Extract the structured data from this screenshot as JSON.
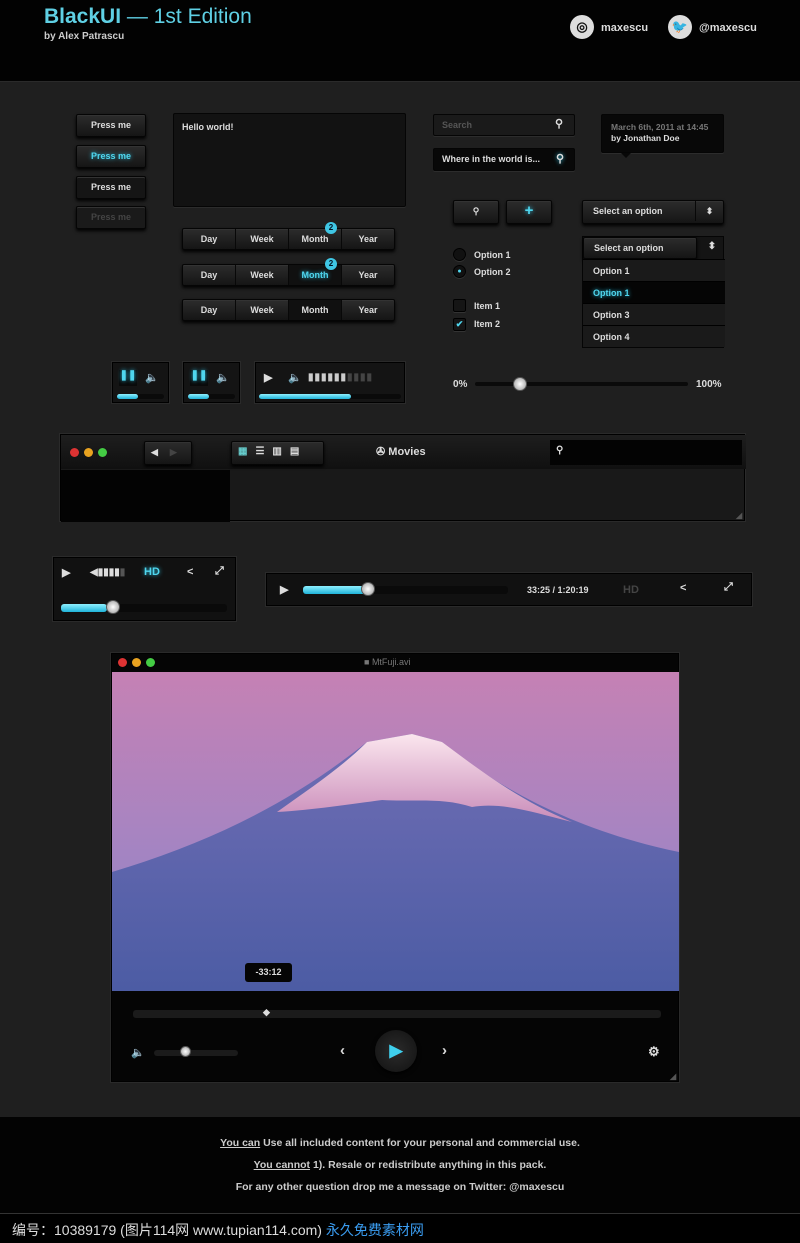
{
  "header": {
    "title_brand": "BlackUI",
    "title_rest": " — 1st Edition",
    "byline": "by Alex Patrascu",
    "social": [
      {
        "icon": "dribbble-icon",
        "label": "maxescu"
      },
      {
        "icon": "twitter-icon",
        "label": "@maxescu"
      }
    ]
  },
  "buttons": [
    {
      "label": "Press me",
      "state": "normal"
    },
    {
      "label": "Press me",
      "state": "active"
    },
    {
      "label": "Press me",
      "state": "normal"
    },
    {
      "label": "Press me",
      "state": "disabled"
    }
  ],
  "textarea": {
    "value": "Hello world!"
  },
  "segmented": [
    {
      "items": [
        "Day",
        "Week",
        "Month",
        "Year"
      ],
      "selected": "",
      "badge": "2"
    },
    {
      "items": [
        "Day",
        "Week",
        "Month",
        "Year"
      ],
      "selected": "Month",
      "badge": "2"
    },
    {
      "items": [
        "Day",
        "Week",
        "Month",
        "Year"
      ],
      "selected": "Month"
    }
  ],
  "search1": {
    "placeholder": "Search"
  },
  "search2": {
    "value": "Where in the world is..."
  },
  "tooltip": {
    "date": "March 6th, 2011 at 14:45",
    "author": "by Jonathan Doe"
  },
  "select_closed": {
    "value": "Select an option"
  },
  "select_open": {
    "value": "Select an option",
    "options": [
      "Option 1",
      "Option 1",
      "Option 3",
      "Option 4"
    ],
    "highlighted": 1
  },
  "radios": [
    {
      "label": "Option 1",
      "checked": false
    },
    {
      "label": "Option 2",
      "checked": true
    }
  ],
  "checkboxes": [
    {
      "label": "Item 1",
      "checked": false
    },
    {
      "label": "Item 2",
      "checked": true
    }
  ],
  "slider": {
    "min_label": "0%",
    "max_label": "100%",
    "value_percent": 21
  },
  "finder": {
    "title": "Movies"
  },
  "player_small": {
    "hd": "HD",
    "progress_percent": 28
  },
  "player_wide": {
    "time": "33:25 / 1:20:19",
    "hd": "HD",
    "progress_percent": 32
  },
  "video": {
    "filename": "MtFuji.avi",
    "tooltip_time": "-33:12",
    "seek_percent": 25,
    "volume_percent": 40
  },
  "footer": {
    "line1_link": "You can",
    "line1_rest": " Use all included content for your personal and commercial use.",
    "line2_link": "You cannot",
    "line2_rest": " 1). Resale or redistribute anything in this pack.",
    "line3": "For any other question drop me a message on Twitter: @maxescu"
  },
  "watermark": {
    "text": "编号：10389179 (图片114网 www.tupian114.com)",
    "link": "永久免费素材网"
  },
  "colors": {
    "accent": "#4fd6ee",
    "background": "#1f1f1f"
  }
}
